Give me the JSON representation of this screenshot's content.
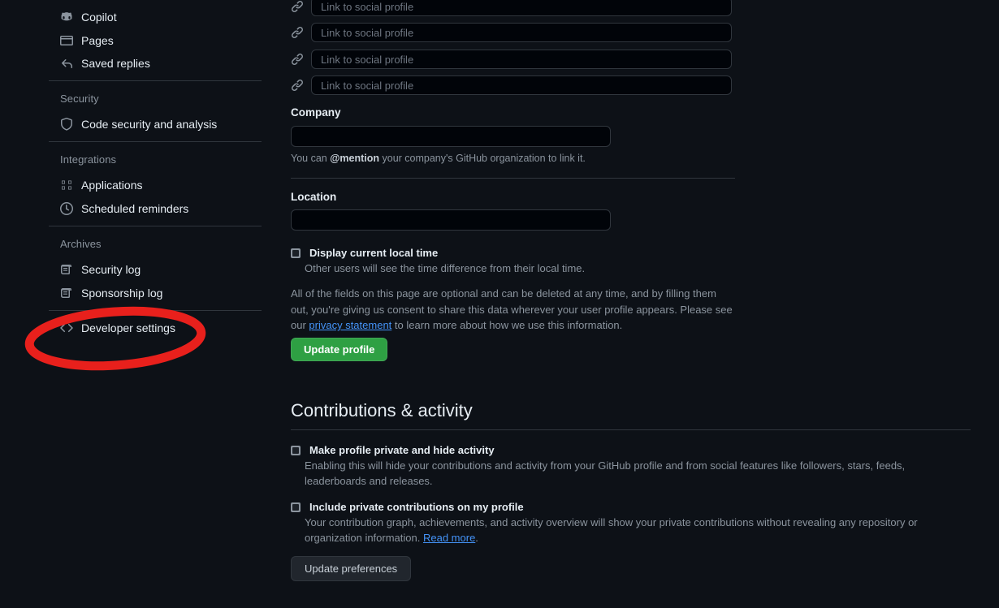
{
  "theme": {
    "background": "#0d1117",
    "text": "#e6edf3",
    "muted": "#8b949e",
    "border": "#30363d",
    "link": "#4493f8",
    "accent_green": "#2ea043",
    "annotation_red": "#e8201c"
  },
  "sidebar": {
    "items": [
      {
        "label": "Copilot",
        "icon": "copilot-icon"
      },
      {
        "label": "Pages",
        "icon": "browser-window-icon"
      },
      {
        "label": "Saved replies",
        "icon": "reply-arrow-icon"
      }
    ],
    "security": {
      "heading": "Security",
      "items": [
        {
          "label": "Code security and analysis",
          "icon": "shield-icon"
        }
      ]
    },
    "integrations": {
      "heading": "Integrations",
      "items": [
        {
          "label": "Applications",
          "icon": "apps-grid-icon"
        },
        {
          "label": "Scheduled reminders",
          "icon": "clock-icon"
        }
      ]
    },
    "archives": {
      "heading": "Archives",
      "items": [
        {
          "label": "Security log",
          "icon": "log-icon"
        },
        {
          "label": "Sponsorship log",
          "icon": "log-icon"
        }
      ]
    },
    "developer": {
      "label": "Developer settings",
      "icon": "code-brackets-icon"
    }
  },
  "profile_form": {
    "social_links": [
      {
        "placeholder": "Link to social profile",
        "value": "",
        "icon": "link-icon"
      },
      {
        "placeholder": "Link to social profile",
        "value": "",
        "icon": "link-icon"
      },
      {
        "placeholder": "Link to social profile",
        "value": "",
        "icon": "link-icon"
      },
      {
        "placeholder": "Link to social profile",
        "value": "",
        "icon": "link-icon"
      }
    ],
    "company": {
      "label": "Company",
      "value": "",
      "placeholder": "",
      "helper_prefix": "You can ",
      "helper_mention": "@mention",
      "helper_suffix": " your company's GitHub organization to link it."
    },
    "location": {
      "label": "Location",
      "value": "",
      "placeholder": ""
    },
    "local_time": {
      "label": "Display current local time",
      "description": "Other users will see the time difference from their local time.",
      "checked": false
    },
    "consent": {
      "part1": "All of the fields on this page are optional and can be deleted at any time, and by filling them out, you're giving us consent to share this data wherever your user profile appears. Please see our ",
      "link": "privacy statement",
      "part2": " to learn more about how we use this information."
    },
    "update_profile_button": "Update profile"
  },
  "contributions": {
    "heading": "Contributions & activity",
    "options": [
      {
        "label": "Make profile private and hide activity",
        "description": "Enabling this will hide your contributions and activity from your GitHub profile and from social features like followers, stars, feeds, leaderboards and releases.",
        "checked": false
      },
      {
        "label": "Include private contributions on my profile",
        "description_part1": "Your contribution graph, achievements, and activity overview will show your private contributions without revealing any repository or organization information. ",
        "description_link": "Read more",
        "description_part2": ".",
        "checked": false
      }
    ],
    "update_preferences_button": "Update preferences"
  },
  "annotation": {
    "shape": "ellipse",
    "target": "Developer settings",
    "color": "#e8201c"
  }
}
